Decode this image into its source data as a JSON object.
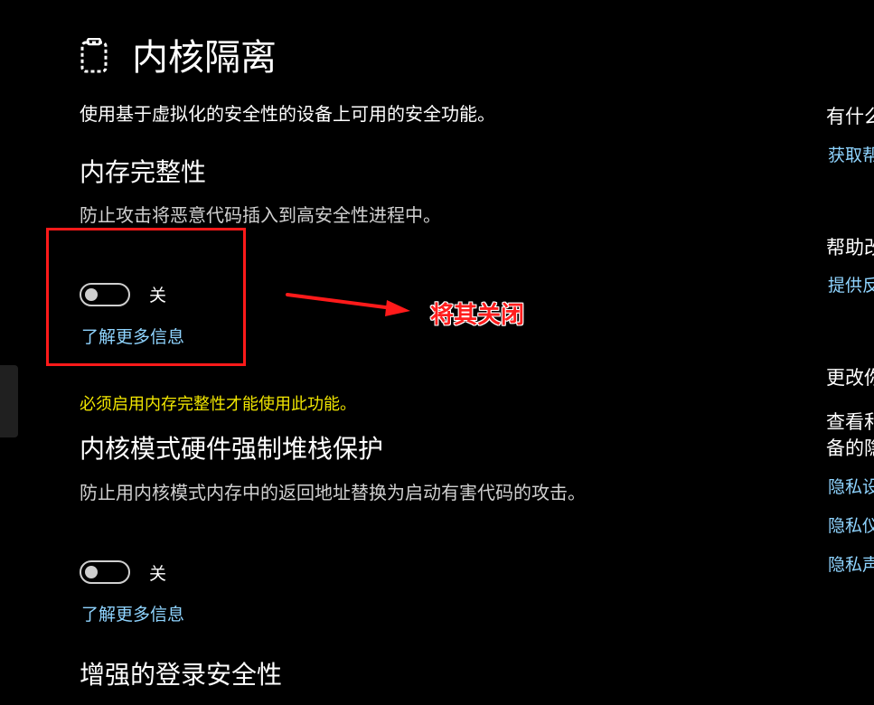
{
  "page": {
    "icon": "core-isolation-icon",
    "title": "内核隔离",
    "description": "使用基于虚拟化的安全性的设备上可用的安全功能。"
  },
  "memory_integrity": {
    "title": "内存完整性",
    "description": "防止攻击将恶意代码插入到高安全性进程中。",
    "toggle": {
      "state": "off",
      "label": "关"
    },
    "learn_more": "了解更多信息"
  },
  "annotation": {
    "text": "将其关闭",
    "color": "#ff1e1e"
  },
  "stack_protection": {
    "warning": "必须启用内存完整性才能使用此功能。",
    "title": "内核模式硬件强制堆栈保护",
    "description": "防止用内核模式内存中的返回地址替换为启动有害代码的攻击。",
    "toggle": {
      "state": "off",
      "label": "关"
    },
    "learn_more": "了解更多信息"
  },
  "login_security": {
    "title": "增强的登录安全性"
  },
  "sidebar": {
    "question_heading": "有什么",
    "get_help_link": "获取帮",
    "help_improve_heading": "帮助改",
    "feedback_link": "提供反",
    "privacy_heading": "更改你",
    "privacy_text_line1": "查看和",
    "privacy_text_line2": "备的隐",
    "privacy_link_1": "隐私设",
    "privacy_link_2": "隐私仪",
    "privacy_link_3": "隐私声"
  },
  "colors": {
    "background": "#000000",
    "link": "#8fd4ff",
    "warning": "#f1e600",
    "highlight_box": "#ff1a1a"
  }
}
